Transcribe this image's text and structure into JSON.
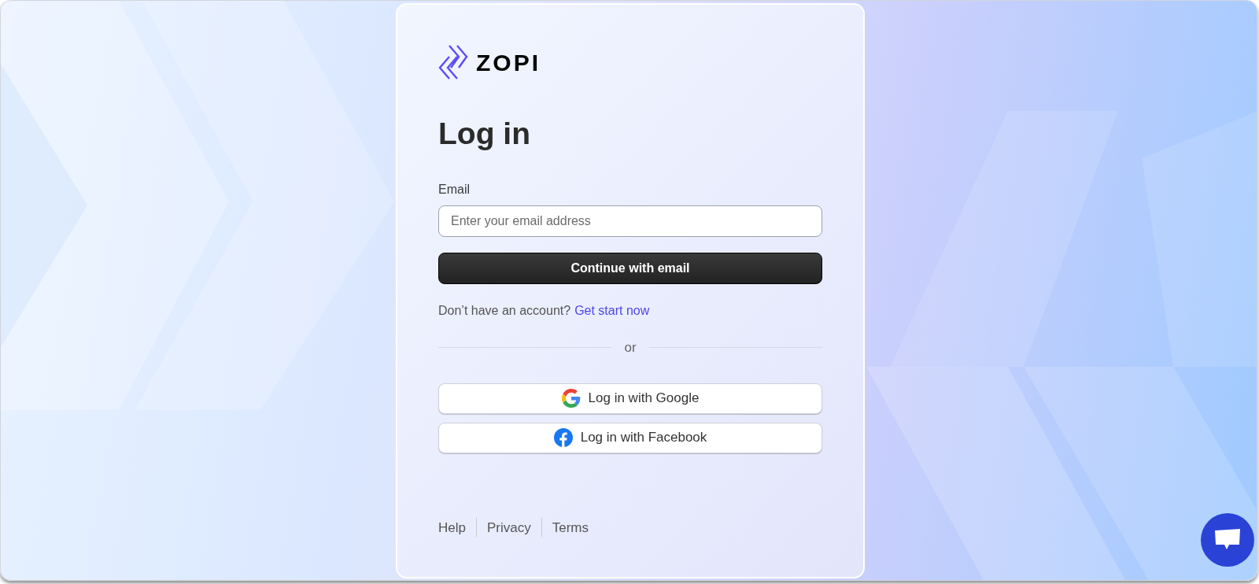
{
  "logo": {
    "text": "ZOPI"
  },
  "heading": "Log in",
  "email": {
    "label": "Email",
    "placeholder": "Enter your email address"
  },
  "continue_button": "Continue with email",
  "signup": {
    "text": "Don’t have an account?",
    "link": "Get start now"
  },
  "divider": "or",
  "social_buttons": [
    {
      "kind": "google",
      "label": "Log in with Google"
    },
    {
      "kind": "facebook",
      "label": "Log in with Facebook"
    }
  ],
  "footer_links": [
    "Help",
    "Privacy",
    "Terms"
  ]
}
